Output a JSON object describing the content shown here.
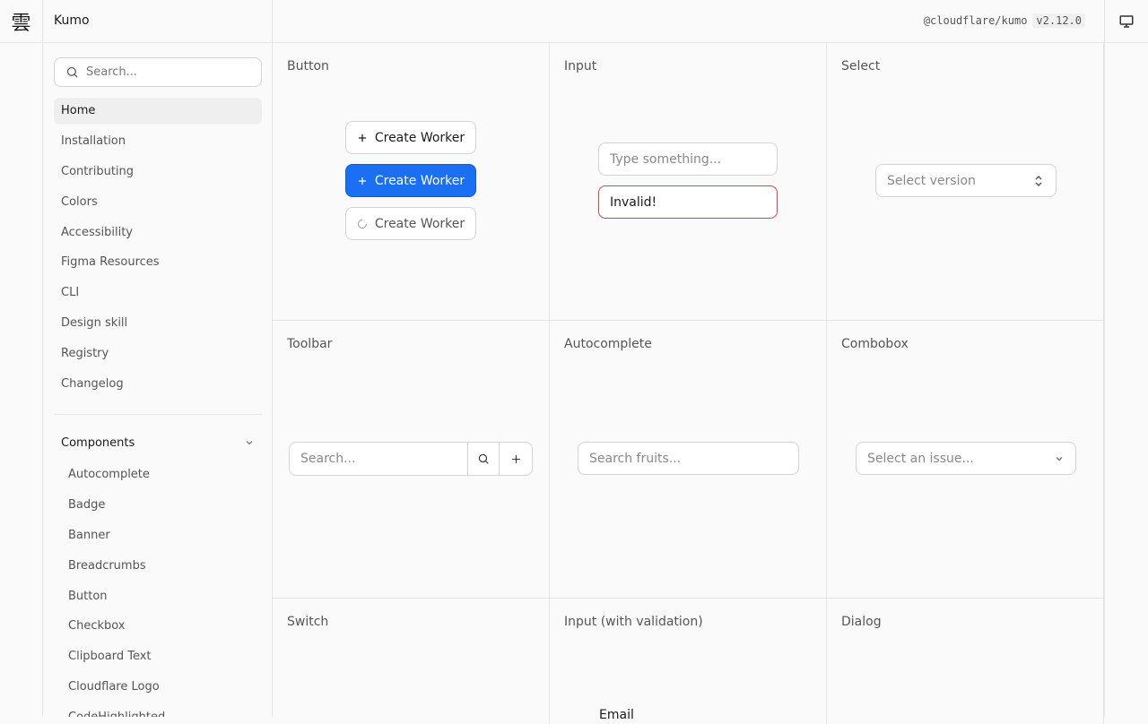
{
  "app": {
    "logo_glyph": "雲",
    "title": "Kumo"
  },
  "package": {
    "name": "@cloudflare/kumo",
    "version": "v2.12.0"
  },
  "icons": {
    "monitor": "monitor-icon",
    "search": "search-icon",
    "chevron": "chevron-down-icon",
    "plus": "plus-icon"
  },
  "sidebar": {
    "search_placeholder": "Search...",
    "items": [
      {
        "label": "Home",
        "active": true
      },
      {
        "label": "Installation"
      },
      {
        "label": "Contributing"
      },
      {
        "label": "Colors"
      },
      {
        "label": "Accessibility"
      },
      {
        "label": "Figma Resources"
      },
      {
        "label": "CLI"
      },
      {
        "label": "Design skill"
      },
      {
        "label": "Registry"
      },
      {
        "label": "Changelog"
      }
    ],
    "section_label": "Components",
    "components": [
      "Autocomplete",
      "Badge",
      "Banner",
      "Breadcrumbs",
      "Button",
      "Checkbox",
      "Clipboard Text",
      "Cloudflare Logo",
      "CodeHighlighted"
    ]
  },
  "cells": {
    "button": {
      "title": "Button",
      "outline_label": "Create Worker",
      "primary_label": "Create Worker",
      "loading_label": "Create Worker"
    },
    "input": {
      "title": "Input",
      "placeholder": "Type something...",
      "invalid_value": "Invalid!"
    },
    "select": {
      "title": "Select",
      "placeholder": "Select version"
    },
    "toolbar": {
      "title": "Toolbar",
      "placeholder": "Search..."
    },
    "autocomplete": {
      "title": "Autocomplete",
      "placeholder": "Search fruits..."
    },
    "combobox": {
      "title": "Combobox",
      "placeholder": "Select an issue..."
    },
    "switch": {
      "title": "Switch"
    },
    "input_validation": {
      "title": "Input (with validation)",
      "field_label": "Email"
    },
    "dialog": {
      "title": "Dialog"
    }
  },
  "colors": {
    "accent": "#1a6ff3",
    "error": "#d64545",
    "border": "#e5e5e5"
  }
}
